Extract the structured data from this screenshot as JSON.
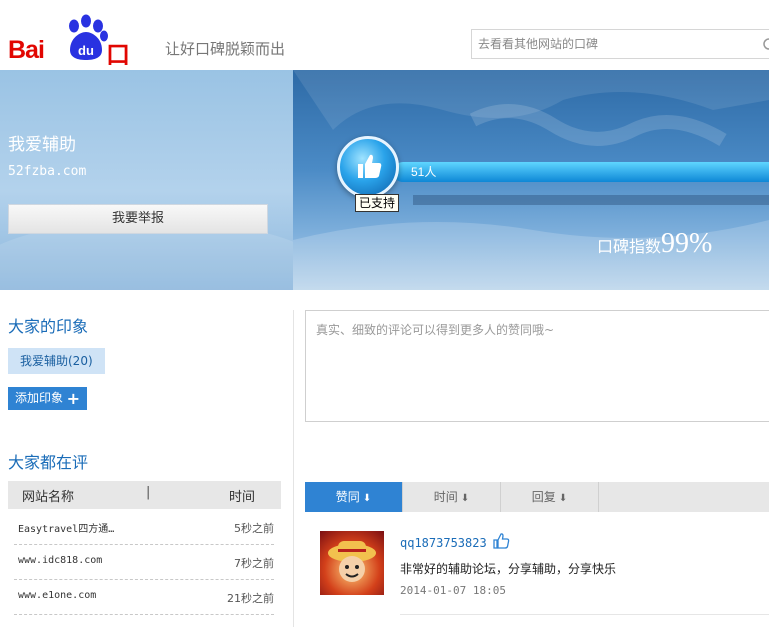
{
  "header": {
    "logo_text_bai": "Bai",
    "logo_text_du": "du",
    "logo_text_koubei": "口碑",
    "slogan": "让好口碑脱颖而出",
    "search_placeholder": "去看看其他网站的口碑"
  },
  "site": {
    "name": "我爱辅助",
    "url": "52fzba.com",
    "report_button": "我要举报"
  },
  "rating": {
    "supporters": "51人",
    "supported_label": "已支持",
    "index_label": "口碑指数",
    "index_value": "99%",
    "index_fraction": 0.99
  },
  "impressions": {
    "title": "大家的印象",
    "tags": [
      "我爱辅助(20)"
    ],
    "add_button": "添加印象"
  },
  "reviewing": {
    "title": "大家都在评",
    "col_site": "网站名称",
    "col_sep": "|",
    "col_time": "时间",
    "rows": [
      {
        "url": "Easytravel四方通…",
        "time": "5秒之前"
      },
      {
        "url": "www.idc818.com",
        "time": "7秒之前"
      },
      {
        "url": "www.e1one.com",
        "time": "21秒之前"
      }
    ]
  },
  "comment": {
    "placeholder": "真实、细致的评论可以得到更多人的赞同哦~"
  },
  "sort_tabs": [
    {
      "label": "赞同",
      "active": true
    },
    {
      "label": "时间",
      "active": false
    },
    {
      "label": "回复",
      "active": false
    }
  ],
  "review": {
    "username": "qq1873753823",
    "text": "非常好的辅助论坛，分享辅助，分享快乐",
    "time": "2014-01-07 18:05"
  },
  "colors": {
    "brand_red": "#e10601",
    "accent_blue": "#2f83d3",
    "title_blue": "#1a6cb8"
  }
}
